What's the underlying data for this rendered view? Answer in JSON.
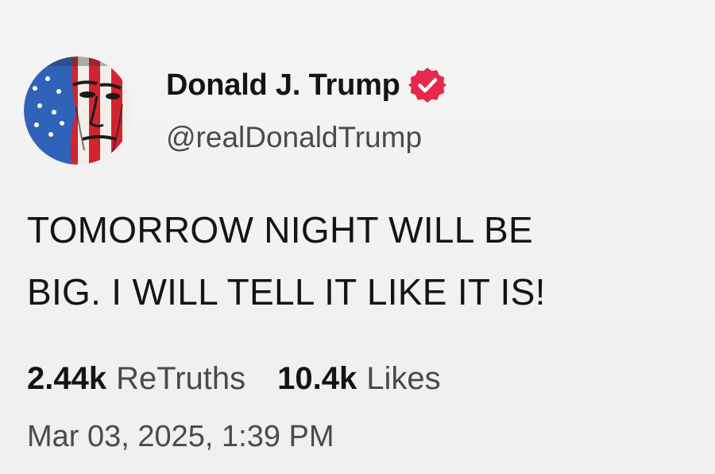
{
  "author": {
    "display_name": "Donald J. Trump",
    "handle": "@realDonaldTrump",
    "avatar_icon": "avatar-flag-portrait",
    "verified_icon": "verified-badge-icon",
    "verified_color": "#e5284b"
  },
  "post": {
    "text": "TOMORROW NIGHT WILL BE\nBIG. I WILL TELL IT LIKE IT IS!"
  },
  "stats": {
    "retruths_count": "2.44k",
    "retruths_label": "ReTruths",
    "likes_count": "10.4k",
    "likes_label": "Likes"
  },
  "timestamp": "Mar 03, 2025, 1:39 PM"
}
